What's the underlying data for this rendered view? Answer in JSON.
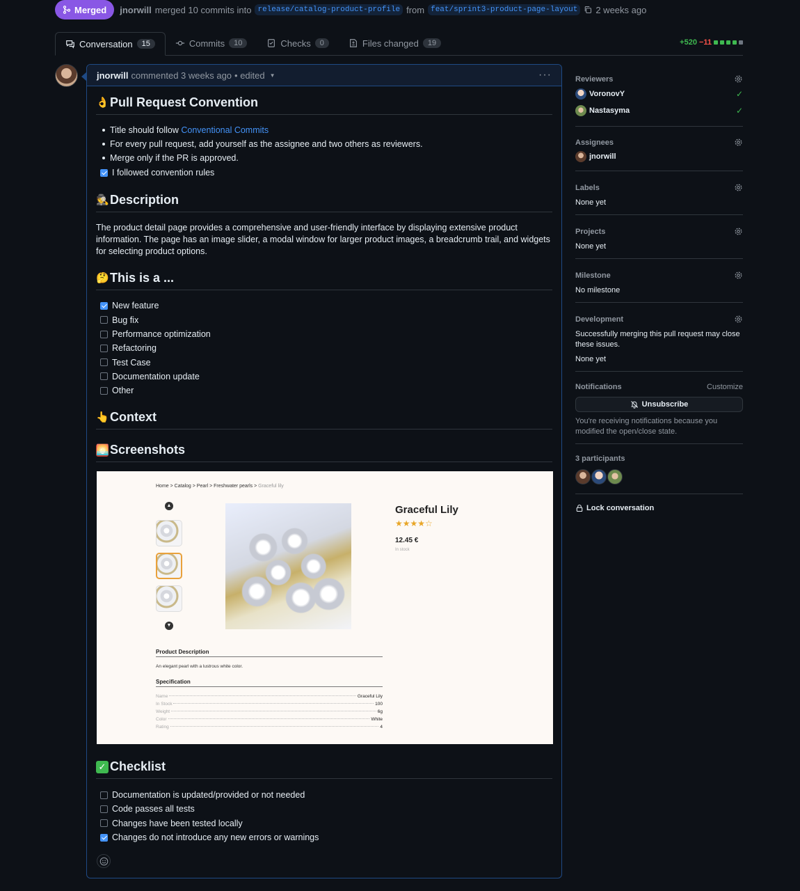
{
  "header": {
    "status": "Merged",
    "author": "jnorwill",
    "merge_text": "merged 10 commits into",
    "base_branch": "release/catalog-product-profile",
    "from_text": "from",
    "head_branch": "feat/sprint3-product-page-layout",
    "time": "2 weeks ago"
  },
  "tabs": [
    {
      "label": "Conversation",
      "count": "15"
    },
    {
      "label": "Commits",
      "count": "10"
    },
    {
      "label": "Checks",
      "count": "0"
    },
    {
      "label": "Files changed",
      "count": "19"
    }
  ],
  "diffstat": {
    "additions": "+520",
    "deletions": "−11"
  },
  "comment": {
    "author": "jnorwill",
    "meta": "commented 3 weeks ago",
    "edited": "• edited",
    "convention": {
      "heading": "Pull Request Convention",
      "bullet1_prefix": "Title should follow",
      "bullet1_link": "Conventional Commits",
      "bullet2": "For every pull request, add yourself as the assignee and two others as reviewers.",
      "bullet3": "Merge only if the PR is approved.",
      "task": "I followed convention rules"
    },
    "description": {
      "heading": "Description",
      "text": "The product detail page provides a comprehensive and user-friendly interface by displaying extensive product information. The page has an image slider, a modal window for larger product images, a breadcrumb trail, and widgets for selecting product options."
    },
    "type": {
      "heading": "This is a ...",
      "options": [
        {
          "label": "New feature",
          "checked": true
        },
        {
          "label": "Bug fix",
          "checked": false
        },
        {
          "label": "Performance optimization",
          "checked": false
        },
        {
          "label": "Refactoring",
          "checked": false
        },
        {
          "label": "Test Case",
          "checked": false
        },
        {
          "label": "Documentation update",
          "checked": false
        },
        {
          "label": "Other",
          "checked": false
        }
      ]
    },
    "context_heading": "Context",
    "screenshots_heading": "Screenshots",
    "checklist": {
      "heading": "Checklist",
      "items": [
        {
          "label": "Documentation is updated/provided or not needed",
          "checked": false
        },
        {
          "label": "Code passes all tests",
          "checked": false
        },
        {
          "label": "Changes have been tested locally",
          "checked": false
        },
        {
          "label": "Changes do not introduce any new errors or warnings",
          "checked": true
        }
      ]
    }
  },
  "screenshot": {
    "breadcrumb": [
      "Home",
      "Catalog",
      "Pearl",
      "Freshwater pearls",
      "Graceful lily"
    ],
    "product_title": "Graceful Lily",
    "stars": "★★★★☆",
    "price": "12.45 €",
    "stock": "In stock",
    "desc_heading": "Product Description",
    "desc_text": "An elegant pearl with a lustrous white color.",
    "spec_heading": "Specification",
    "specs": [
      {
        "k": "Name",
        "v": "Graceful Lily"
      },
      {
        "k": "In Stock",
        "v": "100"
      },
      {
        "k": "Weight",
        "v": "6g"
      },
      {
        "k": "Color",
        "v": "White"
      },
      {
        "k": "Rating",
        "v": "4"
      }
    ]
  },
  "sidebar": {
    "reviewers": {
      "title": "Reviewers",
      "people": [
        "VoronovY",
        "Nastasyma"
      ]
    },
    "assignees": {
      "title": "Assignees",
      "people": [
        "jnorwill"
      ]
    },
    "labels": {
      "title": "Labels",
      "value": "None yet"
    },
    "projects": {
      "title": "Projects",
      "value": "None yet"
    },
    "milestone": {
      "title": "Milestone",
      "value": "No milestone"
    },
    "development": {
      "title": "Development",
      "text": "Successfully merging this pull request may close these issues.",
      "value": "None yet"
    },
    "notifications": {
      "title": "Notifications",
      "customize": "Customize",
      "button": "Unsubscribe",
      "reason": "You're receiving notifications because you modified the open/close state."
    },
    "participants": {
      "title": "3 participants"
    },
    "lock": "Lock conversation"
  },
  "colors": {
    "merged": "#8957e5",
    "link": "#4493f8",
    "add": "#3fb950",
    "del": "#f85149"
  }
}
